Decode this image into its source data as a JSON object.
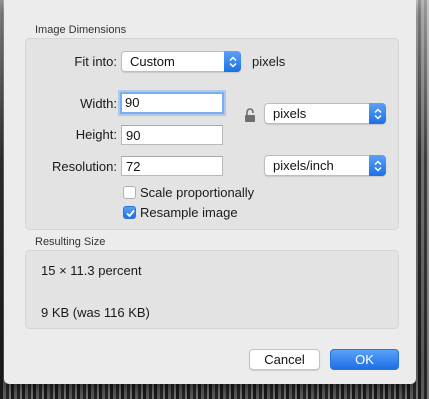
{
  "dialog": {
    "image_dimensions_title": "Image Dimensions",
    "fit_into": {
      "label": "Fit into:",
      "selected": "Custom",
      "unit_label": "pixels"
    },
    "width": {
      "label": "Width:",
      "value": "90"
    },
    "height": {
      "label": "Height:",
      "value": "90"
    },
    "size_unit": {
      "selected": "pixels"
    },
    "resolution": {
      "label": "Resolution:",
      "value": "72",
      "unit_selected": "pixels/inch"
    },
    "scale_proportionally": {
      "label": "Scale proportionally",
      "checked": false
    },
    "resample_image": {
      "label": "Resample image",
      "checked": true
    },
    "resulting_size_title": "Resulting Size",
    "resulting_dimensions": "15 × 11.3 percent",
    "resulting_filesize": "9 KB (was 116 KB)",
    "buttons": {
      "cancel": "Cancel",
      "ok": "OK"
    }
  },
  "icons": {
    "lock": "unlocked-padlock-icon",
    "popup_arrows": "up-down-chevron-icon",
    "checkmark": "checkmark-icon"
  },
  "colors": {
    "accent": "#1d6fe5",
    "focus_ring": "#7aaef2",
    "sheet_bg": "#ececec"
  }
}
